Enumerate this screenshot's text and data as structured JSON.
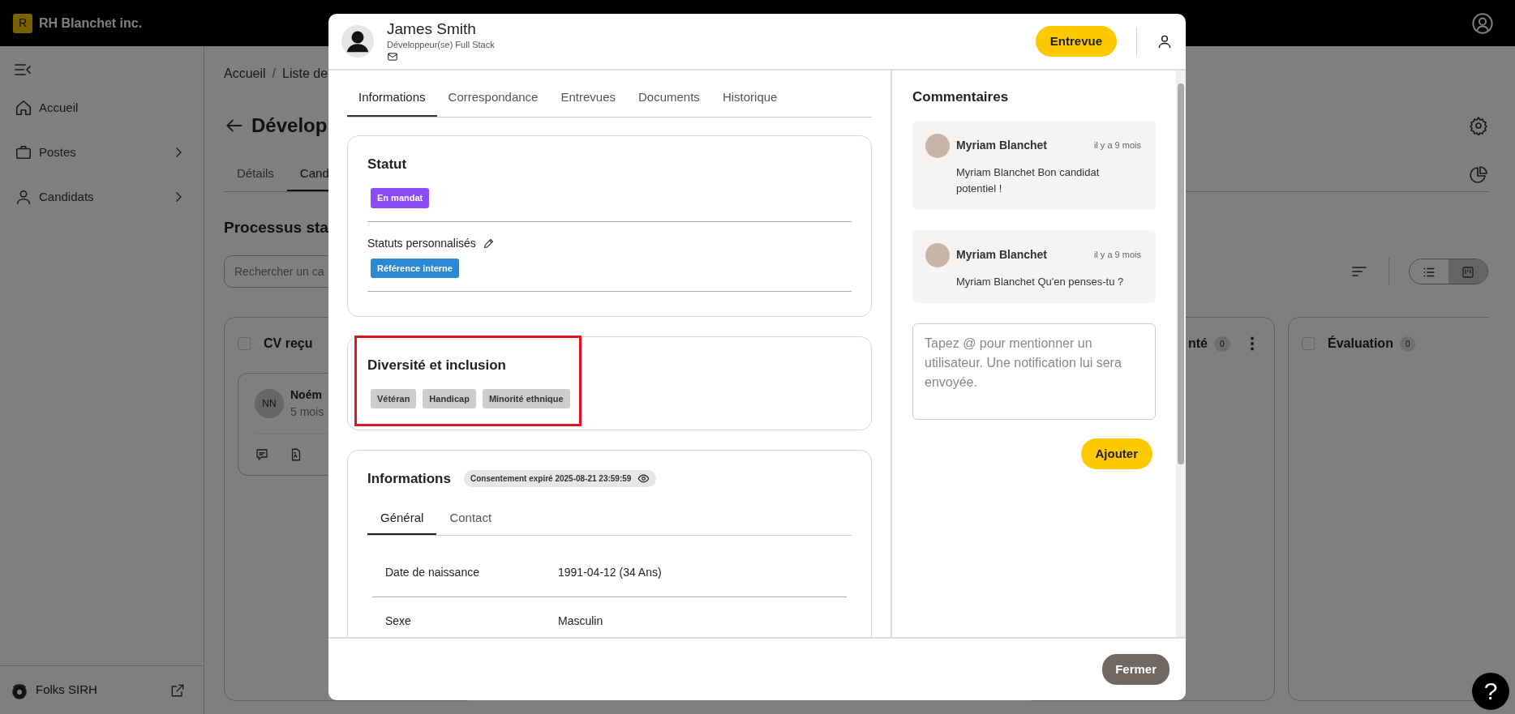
{
  "app_bar": {
    "logo_letter": "R",
    "company": "RH Blanchet inc."
  },
  "sidebar": {
    "items": [
      {
        "label": "Accueil",
        "has_submenu": false
      },
      {
        "label": "Postes",
        "has_submenu": true
      },
      {
        "label": "Candidats",
        "has_submenu": true
      }
    ],
    "footer": {
      "label": "Folks SIRH"
    }
  },
  "page": {
    "breadcrumb": [
      "Accueil",
      "Liste de"
    ],
    "breadcrumb_separator": "/",
    "title": "Dévelop",
    "tabs": [
      {
        "label": "Détails",
        "selected": false
      },
      {
        "label": "Cand",
        "selected": true
      }
    ],
    "section_title": "Processus sta",
    "search": {
      "placeholder": "Rechercher un ca"
    },
    "view_toggle": [
      {
        "kind": "list",
        "selected": false
      },
      {
        "kind": "board",
        "selected": true
      }
    ],
    "columns": [
      {
        "title": "CV reçu",
        "checked": false,
        "cards": [
          {
            "initials": "NN",
            "name": "Noém",
            "time": "5 mois"
          }
        ]
      },
      {
        "title": "nté",
        "count": "0",
        "menu": true
      },
      {
        "title": "Évaluation",
        "checked": false,
        "count": "0"
      }
    ]
  },
  "modal": {
    "candidate": {
      "name": "James Smith",
      "role": "Développeur(se) Full Stack"
    },
    "action_button": "Entrevue",
    "tabs": [
      {
        "label": "Informations",
        "selected": true
      },
      {
        "label": "Correspondance",
        "selected": false
      },
      {
        "label": "Entrevues",
        "selected": false
      },
      {
        "label": "Documents",
        "selected": false
      },
      {
        "label": "Historique",
        "selected": false
      }
    ],
    "status_card": {
      "title": "Statut",
      "status": {
        "label": "En mandat",
        "color": "#8b4cf6"
      },
      "custom_label": "Statuts personnalisés",
      "custom_tags": [
        {
          "label": "Référence interne",
          "color": "#2a88d4"
        }
      ]
    },
    "diversity_card": {
      "title": "Diversité et inclusion",
      "highlighted": true,
      "tags": [
        "Vétéran",
        "Handicap",
        "Minorité ethnique"
      ]
    },
    "info_card": {
      "title": "Informations",
      "consent": "Consentement expiré 2025-08-21 23:59:59",
      "tabs": [
        {
          "label": "Général",
          "selected": true
        },
        {
          "label": "Contact",
          "selected": false
        }
      ],
      "rows": [
        {
          "label": "Date de naissance",
          "value": "1991-04-12 (34 Ans)"
        },
        {
          "label": "Sexe",
          "value": "Masculin"
        }
      ]
    },
    "comments": {
      "title": "Commentaires",
      "items": [
        {
          "author": "Myriam Blanchet",
          "time": "il y a 9 mois",
          "text": "Myriam Blanchet Bon candidat potentiel !"
        },
        {
          "author": "Myriam Blanchet",
          "time": "il y a 9 mois",
          "text": "Myriam Blanchet Qu'en penses-tu ?"
        }
      ],
      "input": {
        "placeholder": "Tapez @ pour mentionner un utilisateur. Une notification lui sera envoyée."
      },
      "submit": "Ajouter"
    },
    "close_button": "Fermer"
  },
  "help_button": "?"
}
